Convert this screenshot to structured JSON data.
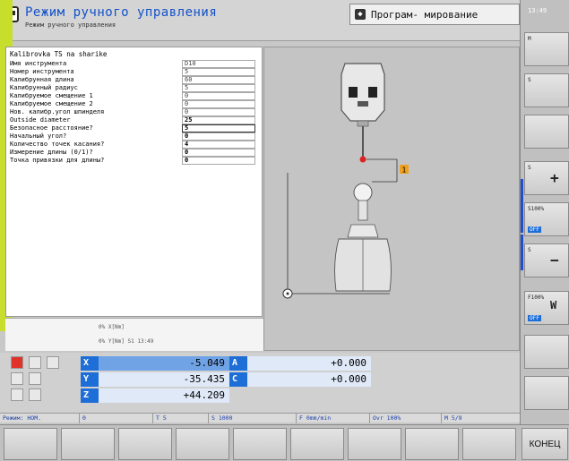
{
  "header": {
    "mode_title": "Режим ручного управления",
    "mode_subtitle": "Режим ручного управления",
    "prog_label": "Програм- мирование"
  },
  "clock": "13:49",
  "form": {
    "title": "Kalibrovka TS na sharike",
    "rows": [
      {
        "label": "Имя инструмента",
        "value": "D10"
      },
      {
        "label": "Номер инструмента",
        "value": "5"
      },
      {
        "label": "Калибрунная длина",
        "value": "60"
      },
      {
        "label": "Калибрунный радиус",
        "value": "5"
      },
      {
        "label": "Калибруемое смещение 1",
        "value": "0"
      },
      {
        "label": "Калибруемое смещение 2",
        "value": "0"
      },
      {
        "label": "Нов. калибр.угол шпинделя",
        "value": "0"
      },
      {
        "label": "Outside diameter",
        "value": "25"
      },
      {
        "label": "Безопасное расстояние?",
        "value": "5"
      },
      {
        "label": "Начальный угол?",
        "value": "0"
      },
      {
        "label": "Количество точек касания?",
        "value": "4"
      },
      {
        "label": "Измерение длины (0/1)?",
        "value": "0"
      },
      {
        "label": "Точка привязки для длины?",
        "value": "0"
      }
    ]
  },
  "graphic": {
    "marker_label": "1"
  },
  "status": {
    "line1": "0% X[Nm]",
    "line2": "0% Y[Nm] S1  13:49"
  },
  "coords": [
    {
      "axis": "X",
      "value": "-5.049",
      "axis2": "A",
      "value2": "+0.000"
    },
    {
      "axis": "Y",
      "value": "-35.435",
      "axis2": "C",
      "value2": "+0.000"
    },
    {
      "axis": "Z",
      "value": "+44.209"
    }
  ],
  "status_line": {
    "mode": "Режим: НОМ.",
    "t": "0",
    "tool": "T 5",
    "s": "S 1000",
    "f": "F 0mm/min",
    "ovr": "Ovr 100%",
    "m": "M 5/9"
  },
  "right_softkeys": [
    {
      "label": "M",
      "glyph": ""
    },
    {
      "label": "S",
      "glyph": ""
    },
    {
      "label": "",
      "glyph": ""
    },
    {
      "label": "S",
      "glyph": "+"
    },
    {
      "label": "S100%",
      "glyph": "",
      "badge": "OFF"
    },
    {
      "label": "S",
      "glyph": "−"
    },
    {
      "label": "F100%",
      "glyph": "W",
      "badge": "OFF"
    },
    {
      "label": "",
      "glyph": ""
    },
    {
      "label": "",
      "glyph": ""
    }
  ],
  "end_label": "КОНЕЦ",
  "colors": {
    "accent_blue": "#1e6ed8",
    "title_blue": "#1452c8",
    "marker_orange": "#f0a020",
    "green_overlay": "#c8de2d"
  }
}
